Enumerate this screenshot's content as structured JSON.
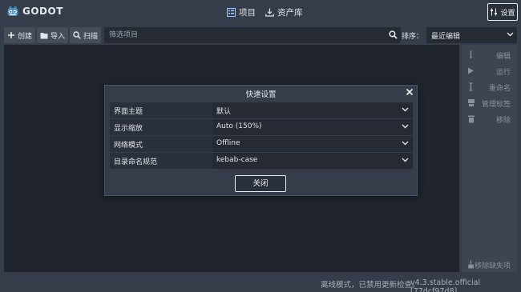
{
  "app": {
    "logo_text": "GODOT"
  },
  "tabs": [
    {
      "label": "项目",
      "icon": "project-list-icon",
      "active": true
    },
    {
      "label": "资产库",
      "icon": "download-icon",
      "active": false
    }
  ],
  "settings_button": {
    "label": "设置",
    "icon": "settings-sliders-icon"
  },
  "toolbar": {
    "create_label": "创建",
    "import_label": "导入",
    "scan_label": "扫描",
    "filter_placeholder": "筛选项目",
    "sort_label": "排序：",
    "sort_value": "最近编辑"
  },
  "side_panel": {
    "items": [
      {
        "label": "编辑",
        "icon": "edit-icon",
        "enabled": false
      },
      {
        "label": "运行",
        "icon": "play-icon",
        "enabled": false
      },
      {
        "label": "重命名",
        "icon": "rename-icon",
        "enabled": false
      },
      {
        "label": "管理标签",
        "icon": "tag-icon",
        "enabled": false
      },
      {
        "label": "移除",
        "icon": "trash-icon",
        "enabled": false
      }
    ],
    "remove_missing_label": "移除缺失项"
  },
  "modal": {
    "title": "快速设置",
    "rows": [
      {
        "label": "界面主题",
        "value": "默认"
      },
      {
        "label": "显示缩放",
        "value": "Auto (150%)"
      },
      {
        "label": "网络模式",
        "value": "Offline"
      },
      {
        "label": "目录命名规范",
        "value": "kebab-case"
      }
    ],
    "close_label": "关闭"
  },
  "status": {
    "message": "离线模式，已禁用更新检查。",
    "version": "v4.3.stable.official [77dcf97d8]"
  },
  "colors": {
    "background": "#363d4a",
    "list_background": "#20252d",
    "accent": "#478cbf",
    "active_tab_icon": "#9cc6ff"
  }
}
